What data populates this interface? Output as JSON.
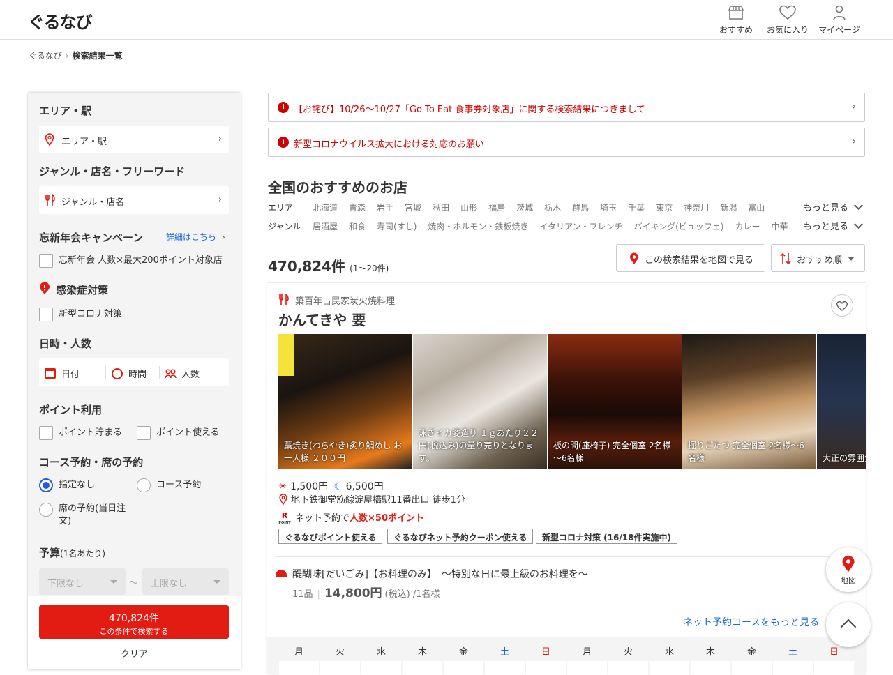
{
  "header": {
    "logo": "ぐるなび",
    "nav": [
      {
        "label": "おすすめ",
        "icon": "store-icon"
      },
      {
        "label": "お気に入り",
        "icon": "heart-icon"
      },
      {
        "label": "マイページ",
        "icon": "user-icon"
      }
    ]
  },
  "breadcrumb": {
    "home": "ぐるなび",
    "current": "検索結果一覧"
  },
  "sidebar": {
    "area_heading": "エリア・駅",
    "area_button": "エリア・駅",
    "genre_heading": "ジャンル・店名・フリーワード",
    "genre_button": "ジャンル・店名",
    "campaign_heading": "忘新年会キャンペーン",
    "campaign_link": "詳細はこちら",
    "campaign_check": "忘新年会 人数×最大200ポイント対象店",
    "infection_heading": "感染症対策",
    "infection_check": "新型コロナ対策",
    "datetime_heading": "日時・人数",
    "date": "日付",
    "time": "時間",
    "people": "人数",
    "points_heading": "ポイント利用",
    "points_save": "ポイント貯まる",
    "points_use": "ポイント使える",
    "reserve_heading": "コース予約・席の予約",
    "reserve_none": "指定なし",
    "reserve_course": "コース予約",
    "reserve_seat": "席の予約(当日注文)",
    "budget_heading": "予算",
    "budget_sub": "(1名あたり)",
    "budget_min": "下限なし",
    "budget_max": "上限なし",
    "budget_tilde": "〜",
    "search_count": "470,824件",
    "search_label": "この条件で検索する",
    "clear": "クリア"
  },
  "notices": [
    "【お詫び】10/26〜10/27「Go To Eat 食事券対象店」に関する検索結果につきまして",
    "新型コロナウイルス拡大における対応のお願い"
  ],
  "recommend": {
    "title": "全国のおすすめのお店",
    "area_label": "エリア",
    "areas": [
      "北海道",
      "青森",
      "岩手",
      "宮城",
      "秋田",
      "山形",
      "福島",
      "茨城",
      "栃木",
      "群馬",
      "埼玉",
      "千葉",
      "東京",
      "神奈川",
      "新潟",
      "富山"
    ],
    "genre_label": "ジャンル",
    "genres": [
      "居酒屋",
      "和食",
      "寿司(すし)",
      "焼肉・ホルモン・鉄板焼き",
      "イタリアン・フレンチ",
      "バイキング(ビュッフェ)",
      "カレー",
      "中華"
    ],
    "more": "もっと見る"
  },
  "results": {
    "count": "470,824件",
    "range": "(1〜20件)",
    "map_button": "この検索結果を地図で見る",
    "sort": "おすすめ順"
  },
  "shop": {
    "genre": "築百年古民家炭火焼料理",
    "name": "かんてきや 要",
    "photos": [
      {
        "caption": "藁焼き(わらやき)炙り鯛めし お一人様 ２００円"
      },
      {
        "caption": "泳ぎイカ姿造り １ｇあたり２２円(税込み)の量り売りとなります。"
      },
      {
        "caption": "板の間(座椅子) 完全個室 2名様～6名様"
      },
      {
        "caption": "掘りごたつ 完全個室 2名様～6名様"
      },
      {
        "caption": "大正の雰囲気の一軒家"
      }
    ],
    "lunch_price": "1,500円",
    "dinner_price": "6,500円",
    "access": "地下鉄御堂筋線淀屋橋駅11番出口 徒歩1分",
    "points_prefix": "ネット予約で",
    "points_bonus": "人数×50ポイント",
    "point_badge": "POINT",
    "tags": [
      "ぐるなびポイント使える",
      "ぐるなびネット予約クーポン使える",
      "新型コロナ対策 (16/18件実施中)"
    ],
    "course_title": "醍醐味[だいごみ]【お料理のみ】　～特別な日に最上級のお料理を～",
    "course_items": "11品",
    "course_price": "14,800円",
    "course_tax": "(税込) /1名様",
    "more_courses": "ネット予約コースをもっと見る",
    "calendar_days": [
      "月",
      "火",
      "水",
      "木",
      "金",
      "土",
      "日",
      "月",
      "火",
      "水",
      "木",
      "金",
      "土",
      "日"
    ]
  },
  "fab": {
    "map": "地図"
  },
  "colors": {
    "brand_red": "#e21c12",
    "link_blue": "#1d6ad8",
    "saturday": "#1d6ad8",
    "sunday": "#e21c12"
  }
}
